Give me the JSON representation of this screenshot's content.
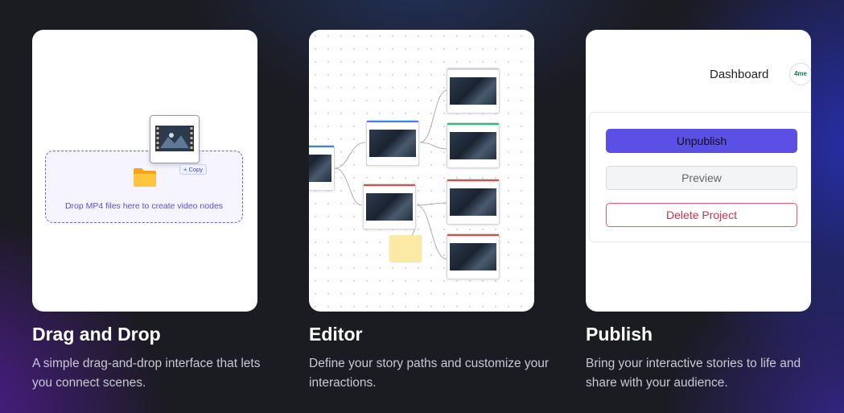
{
  "cards": [
    {
      "title": "Drag and Drop",
      "description": "A simple drag-and-drop interface that lets you connect scenes.",
      "dropzone_text": "Drop MP4 files here to create video nodes",
      "copy_badge": "+ Copy"
    },
    {
      "title": "Editor",
      "description": "Define your story paths and customize your interactions."
    },
    {
      "title": "Publish",
      "description": "Bring your interactive stories to life and share with your audience.",
      "dashboard_title": "Dashboard",
      "avatar_text": "4me",
      "buttons": {
        "unpublish": "Unpublish",
        "preview": "Preview",
        "delete": "Delete Project"
      }
    }
  ],
  "colors": {
    "accent": "#5b4fe6",
    "danger": "#d0304a",
    "node_blue": "#3b82f6",
    "node_green": "#22c55e",
    "node_red": "#ef4444"
  }
}
